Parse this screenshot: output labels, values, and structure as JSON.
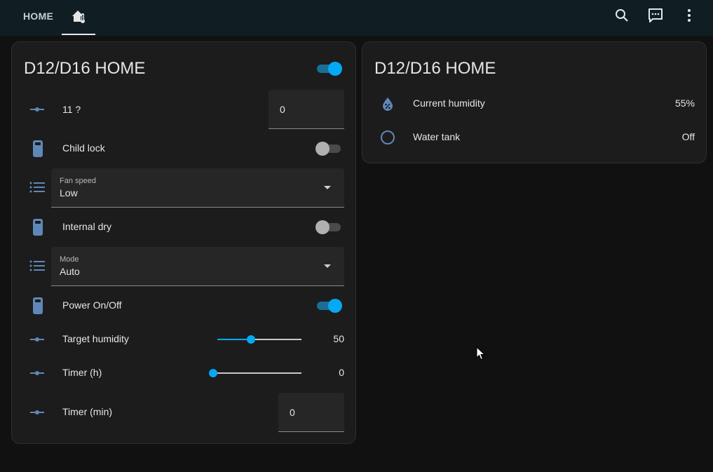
{
  "header": {
    "tab_home": "HOME",
    "tab_device_icon": "home-thermometer-icon",
    "search_icon": "search-icon",
    "assist_icon": "assist-icon",
    "menu_icon": "more-vert-icon"
  },
  "left_card": {
    "title": "D12/D16 HOME",
    "header_toggle_on": true,
    "rows": {
      "r11": {
        "label": "11 ?",
        "value": "0"
      },
      "child_lock": {
        "label": "Child lock",
        "on": false
      },
      "fan_speed": {
        "label": "Fan speed",
        "value": "Low"
      },
      "internal_dry": {
        "label": "Internal dry",
        "on": false
      },
      "mode": {
        "label": "Mode",
        "value": "Auto"
      },
      "power": {
        "label": "Power On/Off",
        "on": true
      },
      "target_humidity": {
        "label": "Target humidity",
        "value": "50",
        "fraction": 0.4
      },
      "timer_h": {
        "label": "Timer (h)",
        "value": "0",
        "fraction": 0
      },
      "timer_min": {
        "label": "Timer (min)",
        "value": "0"
      }
    }
  },
  "right_card": {
    "title": "D12/D16 HOME",
    "current_humidity": {
      "label": "Current humidity",
      "value": "55%"
    },
    "water_tank": {
      "label": "Water tank",
      "value": "Off"
    }
  },
  "colors": {
    "accent": "#03a9f4",
    "icon": "#5f88b8",
    "topbar": "#101e24",
    "card": "#1c1c1c",
    "background": "#111111"
  }
}
